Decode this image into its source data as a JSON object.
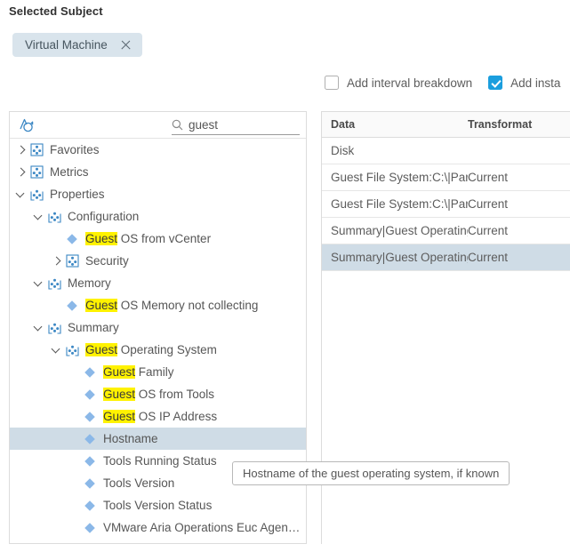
{
  "subject": {
    "title": "Selected Subject",
    "chip_label": "Virtual Machine",
    "chip_close_icon": "close-icon"
  },
  "options": {
    "interval_breakdown": {
      "label": "Add interval breakdown",
      "checked": false
    },
    "instance_breakdown": {
      "label": "Add insta",
      "checked": true
    }
  },
  "tree_panel": {
    "toolbar_icon": "metric-picker-icon",
    "search": {
      "icon": "search-icon",
      "value": "guest",
      "placeholder": ""
    },
    "highlight_term": "Guest",
    "items": [
      {
        "label": "Favorites",
        "pre": "",
        "hl": "",
        "post": "Favorites",
        "depth": 0,
        "type": "folder",
        "state": "collapsed",
        "selected": false
      },
      {
        "label": "Metrics",
        "pre": "",
        "hl": "",
        "post": "Metrics",
        "depth": 0,
        "type": "folder",
        "state": "collapsed",
        "selected": false
      },
      {
        "label": "Properties",
        "pre": "",
        "hl": "",
        "post": "Properties",
        "depth": 0,
        "type": "folder",
        "state": "expanded",
        "selected": false
      },
      {
        "label": "Configuration",
        "pre": "",
        "hl": "",
        "post": "Configuration",
        "depth": 1,
        "type": "folder",
        "state": "expanded",
        "selected": false
      },
      {
        "label": "Guest OS from vCenter",
        "pre": "",
        "hl": "Guest",
        "post": " OS from vCenter",
        "depth": 2,
        "type": "leaf",
        "state": "",
        "selected": false
      },
      {
        "label": "Security",
        "pre": "",
        "hl": "",
        "post": "Security",
        "depth": 2,
        "type": "folder",
        "state": "collapsed",
        "selected": false
      },
      {
        "label": "Memory",
        "pre": "",
        "hl": "",
        "post": "Memory",
        "depth": 1,
        "type": "folder",
        "state": "expanded",
        "selected": false
      },
      {
        "label": "Guest OS Memory not collecting",
        "pre": "",
        "hl": "Guest",
        "post": " OS Memory not collecting",
        "depth": 2,
        "type": "leaf",
        "state": "",
        "selected": false
      },
      {
        "label": "Summary",
        "pre": "",
        "hl": "",
        "post": "Summary",
        "depth": 1,
        "type": "folder",
        "state": "expanded",
        "selected": false
      },
      {
        "label": "Guest Operating System",
        "pre": "",
        "hl": "Guest",
        "post": " Operating System",
        "depth": 2,
        "type": "folder",
        "state": "expanded",
        "selected": false
      },
      {
        "label": "Guest Family",
        "pre": "",
        "hl": "Guest",
        "post": " Family",
        "depth": 3,
        "type": "leaf",
        "state": "",
        "selected": false
      },
      {
        "label": "Guest OS from Tools",
        "pre": "",
        "hl": "Guest",
        "post": " OS from Tools",
        "depth": 3,
        "type": "leaf",
        "state": "",
        "selected": false
      },
      {
        "label": "Guest OS IP Address",
        "pre": "",
        "hl": "Guest",
        "post": " OS IP Address",
        "depth": 3,
        "type": "leaf",
        "state": "",
        "selected": false
      },
      {
        "label": "Hostname",
        "pre": "",
        "hl": "",
        "post": "Hostname",
        "depth": 3,
        "type": "leaf",
        "state": "",
        "selected": true
      },
      {
        "label": "Tools Running Status",
        "pre": "",
        "hl": "",
        "post": "Tools Running Status",
        "depth": 3,
        "type": "leaf",
        "state": "",
        "selected": false
      },
      {
        "label": "Tools Version",
        "pre": "",
        "hl": "",
        "post": "Tools Version",
        "depth": 3,
        "type": "leaf",
        "state": "",
        "selected": false
      },
      {
        "label": "Tools Version Status",
        "pre": "",
        "hl": "",
        "post": "Tools Version Status",
        "depth": 3,
        "type": "leaf",
        "state": "",
        "selected": false
      },
      {
        "label": "VMware Aria Operations Euc Agen…",
        "pre": "",
        "hl": "",
        "post": "VMware Aria Operations Euc Agen…",
        "depth": 3,
        "type": "leaf",
        "state": "",
        "selected": false
      }
    ]
  },
  "data_table": {
    "columns": {
      "data": "Data",
      "transformation": "Transformat"
    },
    "rows": [
      {
        "data": "Disk",
        "transformation": "",
        "selected": false
      },
      {
        "data": "Guest File System:C:\\|Partition …",
        "transformation": "Current",
        "selected": false
      },
      {
        "data": "Guest File System:C:\\|Partition …",
        "transformation": "Current",
        "selected": false
      },
      {
        "data": "Summary|Guest Operating Syst…",
        "transformation": "Current",
        "selected": false
      },
      {
        "data": "Summary|Guest Operating Syst…",
        "transformation": "Current",
        "selected": true
      }
    ]
  },
  "tooltip": {
    "text": "Hostname of the guest operating system, if known"
  }
}
